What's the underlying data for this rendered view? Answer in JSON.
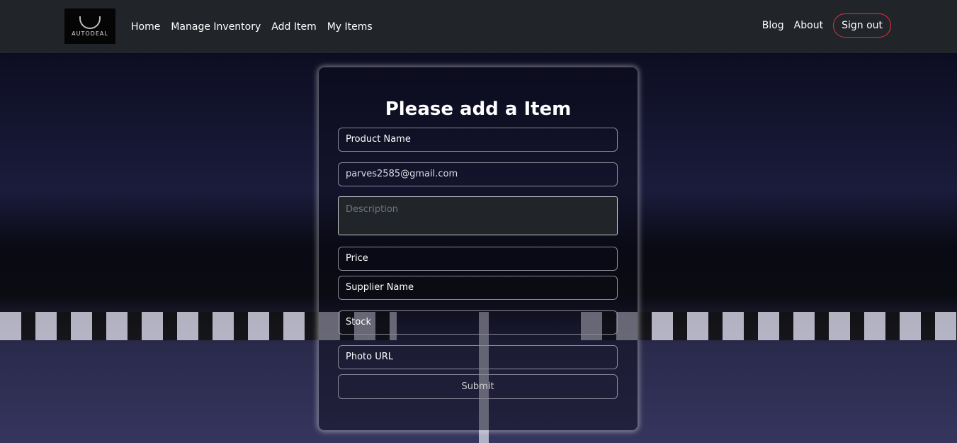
{
  "nav": {
    "logo_text": "AutoDeal",
    "links": [
      "Home",
      "Manage Inventory",
      "Add Item",
      "My Items"
    ],
    "blog": "Blog",
    "about": "About",
    "signout": "Sign out"
  },
  "form": {
    "title": "Please add a Item",
    "product_name": "Product Name",
    "email": "parves2585@gmail.com",
    "description_placeholder": "Description",
    "price": "Price",
    "supplier": "Supplier Name",
    "stock": "Stock",
    "photo": "Photo URL",
    "submit": "Submit"
  },
  "colors": {
    "navbar": "#212529",
    "signout_border": "#dc3545"
  }
}
